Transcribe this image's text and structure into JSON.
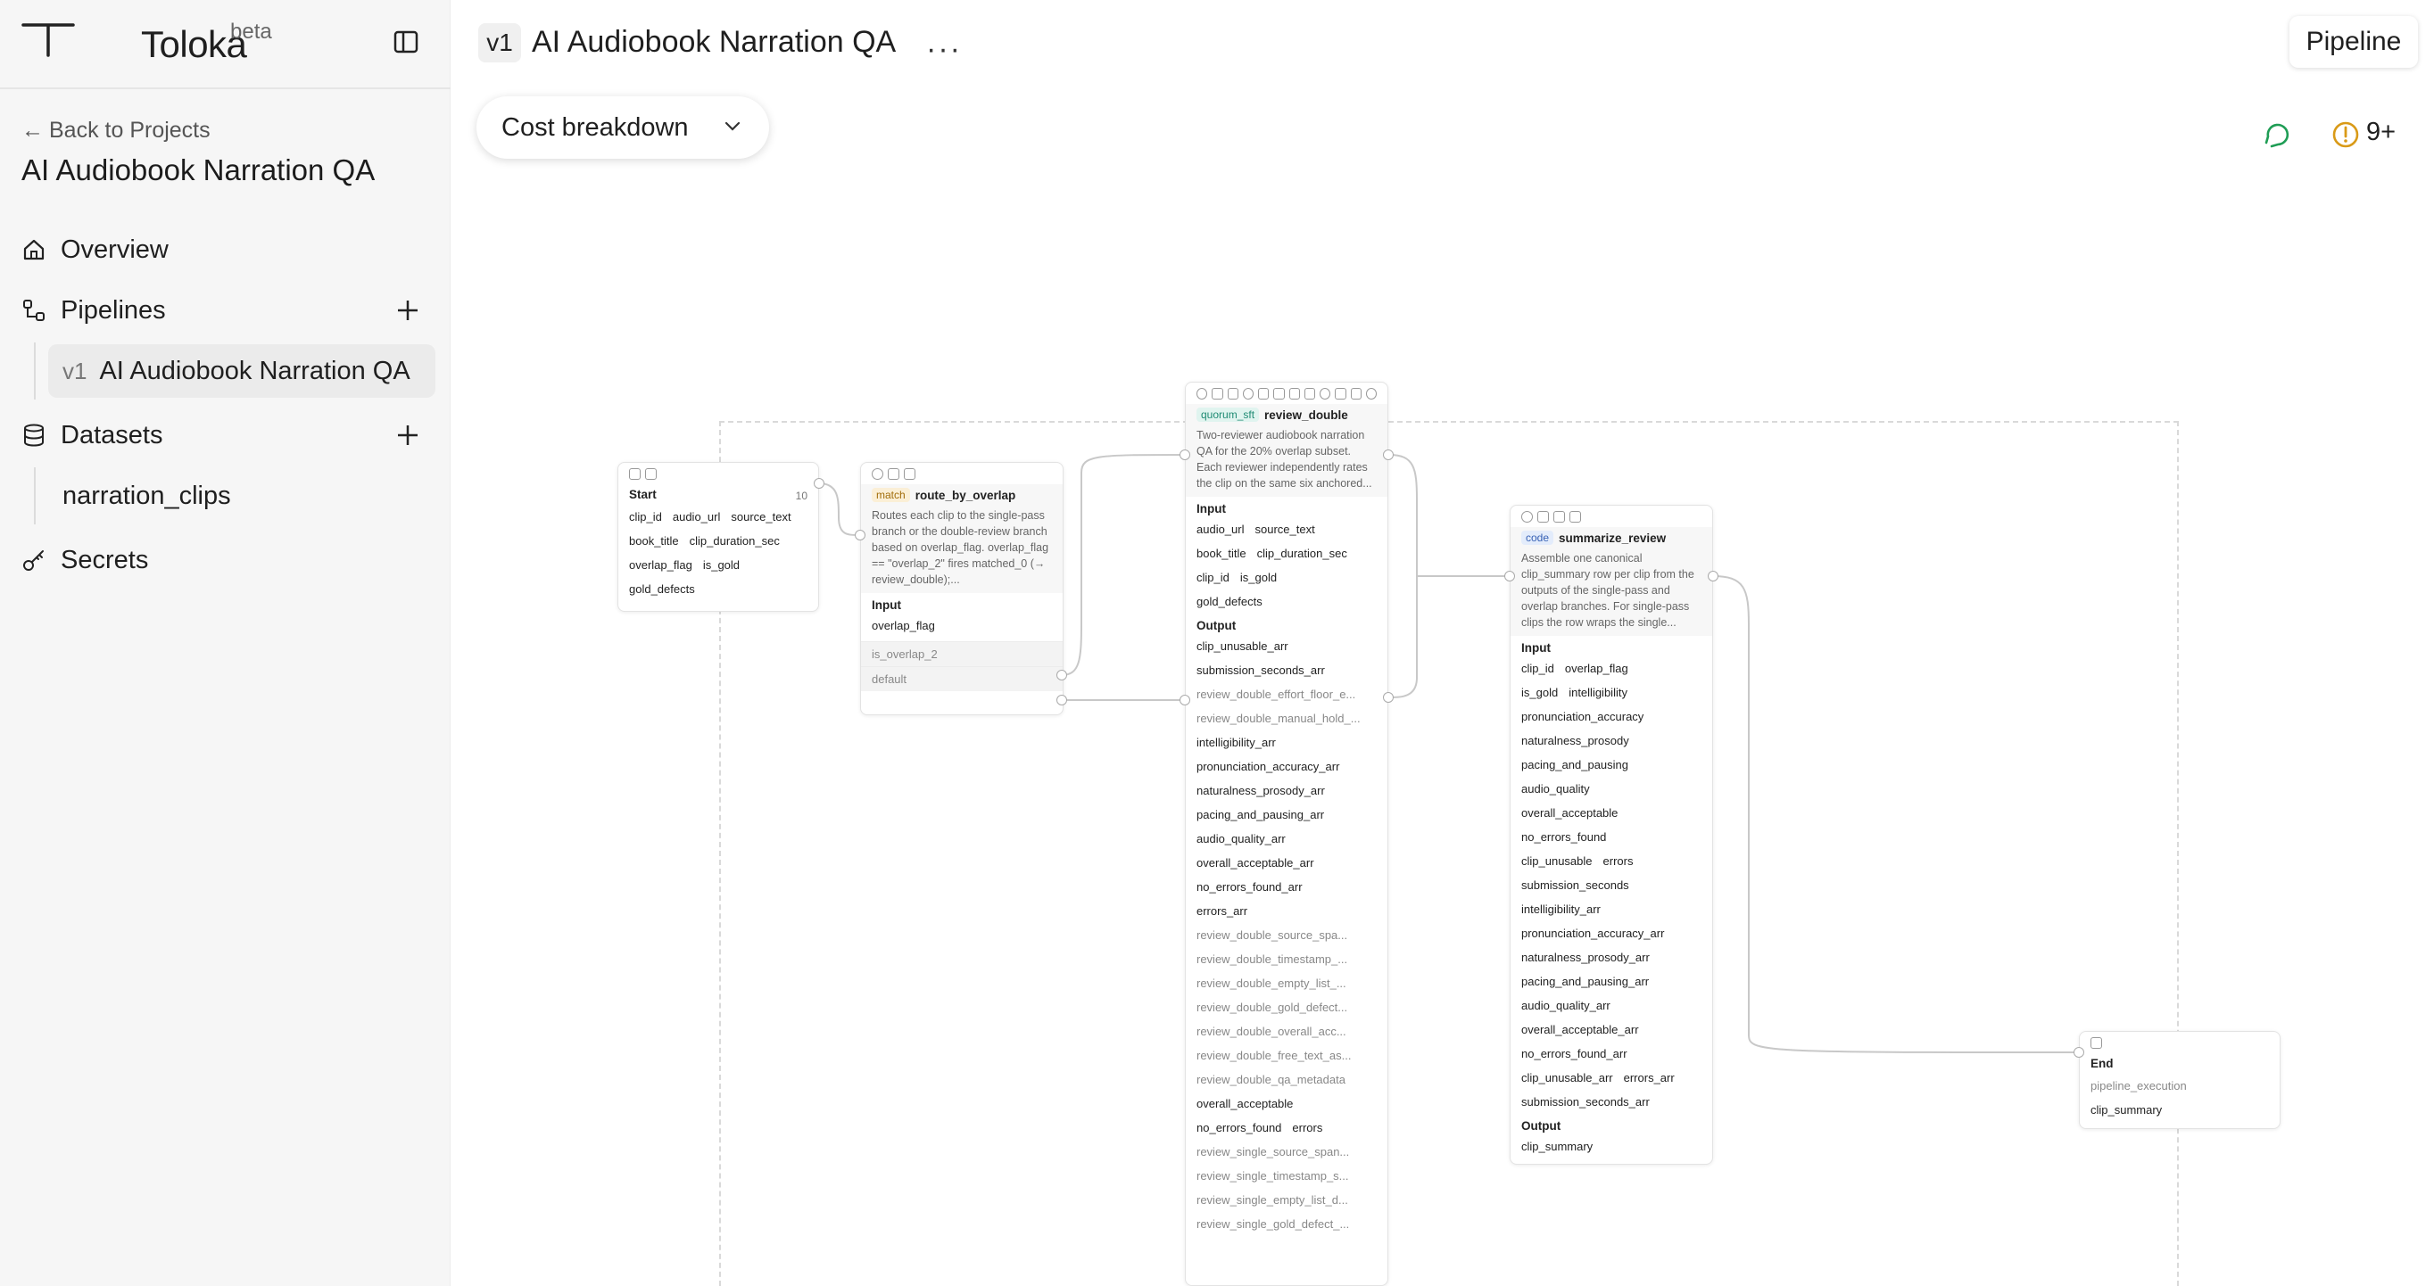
{
  "app": {
    "name": "Toloka",
    "badge": "beta"
  },
  "sidebar": {
    "back_label": "Back to Projects",
    "project_title": "AI Audiobook Narration QA",
    "nav": {
      "overview": "Overview",
      "pipelines": "Pipelines",
      "datasets": "Datasets",
      "secrets": "Secrets"
    },
    "pipeline_item": {
      "version": "v1",
      "label": "AI Audiobook Narration QA"
    },
    "dataset_item": "narration_clips"
  },
  "header": {
    "version": "v1",
    "title": "AI Audiobook Narration QA",
    "more": "···",
    "pipeline_button": "Pipeline",
    "cost_button": "Cost breakdown",
    "warnings": "9+"
  },
  "nodes": {
    "start": {
      "title": "Start",
      "count": "10",
      "fields": [
        [
          "clip_id",
          "audio_url",
          "source_text"
        ],
        [
          "book_title",
          "clip_duration_sec"
        ],
        [
          "overlap_flag",
          "is_gold"
        ],
        [
          "gold_defects"
        ]
      ]
    },
    "route": {
      "tag": "match",
      "title": "route_by_overlap",
      "desc": "Routes each clip to the single-pass branch or the double-review branch based on overlap_flag. overlap_flag == \"overlap_2\" fires matched_0 (→ review_double);...",
      "input_label": "Input",
      "inputs": [
        "overlap_flag"
      ],
      "branches": [
        "is_overlap_2",
        "default"
      ]
    },
    "review": {
      "tag": "quorum_sft",
      "title": "review_double",
      "desc": "Two-reviewer audiobook narration QA for the 20% overlap subset. Each reviewer independently rates the clip on the same six anchored...",
      "input_label": "Input",
      "inputs": [
        [
          "audio_url",
          "source_text"
        ],
        [
          "book_title",
          "clip_duration_sec"
        ],
        [
          "clip_id",
          "is_gold"
        ],
        [
          "gold_defects"
        ]
      ],
      "output_label": "Output",
      "outputs": [
        "clip_unusable_arr",
        "submission_seconds_arr",
        "review_double_effort_floor_e...",
        "review_double_manual_hold_...",
        "intelligibility_arr",
        "pronunciation_accuracy_arr",
        "naturalness_prosody_arr",
        "pacing_and_pausing_arr",
        "audio_quality_arr",
        "overall_acceptable_arr",
        "no_errors_found_arr",
        "errors_arr",
        "review_double_source_spa...",
        "review_double_timestamp_...",
        "review_double_empty_list_...",
        "review_double_gold_defect...",
        "review_double_overall_acc...",
        "review_double_free_text_as...",
        "review_double_qa_metadata"
      ],
      "below": [
        "overall_acceptable",
        "no_errors_found",
        "errors",
        "review_single_source_span...",
        "review_single_timestamp_s...",
        "review_single_empty_list_d...",
        "review_single_gold_defect_..."
      ]
    },
    "summarize": {
      "tag": "code",
      "title": "summarize_review",
      "desc": "Assemble one canonical clip_summary row per clip from the outputs of the single-pass and overlap branches. For single-pass clips the row wraps the single...",
      "input_label": "Input",
      "inputs": [
        [
          "clip_id",
          "overlap_flag"
        ],
        [
          "is_gold",
          "intelligibility"
        ],
        [
          "pronunciation_accuracy"
        ],
        [
          "naturalness_prosody"
        ],
        [
          "pacing_and_pausing"
        ],
        [
          "audio_quality"
        ],
        [
          "overall_acceptable"
        ],
        [
          "no_errors_found"
        ],
        [
          "clip_unusable",
          "errors"
        ],
        [
          "submission_seconds"
        ],
        [
          "intelligibility_arr"
        ],
        [
          "pronunciation_accuracy_arr"
        ],
        [
          "naturalness_prosody_arr"
        ],
        [
          "pacing_and_pausing_arr"
        ],
        [
          "audio_quality_arr"
        ],
        [
          "overall_acceptable_arr"
        ],
        [
          "no_errors_found_arr"
        ],
        [
          "clip_unusable_arr",
          "errors_arr"
        ],
        [
          "submission_seconds_arr"
        ]
      ],
      "output_label": "Output",
      "outputs": [
        "clip_summary"
      ]
    },
    "end": {
      "title": "End",
      "fields": [
        "pipeline_execution",
        "clip_summary"
      ]
    }
  },
  "colors": {
    "accent_green": "#1f9d55",
    "warning": "#d99a17"
  }
}
